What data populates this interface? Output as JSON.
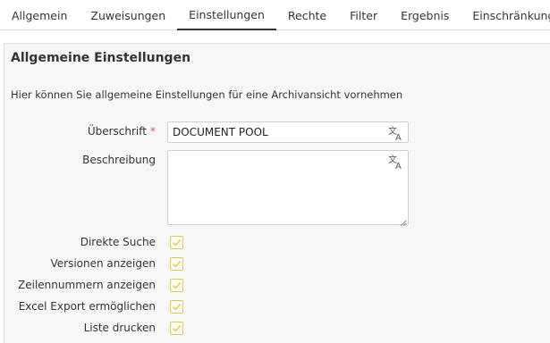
{
  "tabs": [
    {
      "label": "Allgemein"
    },
    {
      "label": "Zuweisungen"
    },
    {
      "label": "Einstellungen",
      "active": true
    },
    {
      "label": "Rechte"
    },
    {
      "label": "Filter"
    },
    {
      "label": "Ergebnis"
    },
    {
      "label": "Einschränkungen"
    }
  ],
  "section": {
    "title": "Allgemeine Einstellungen",
    "description": "Hier können Sie allgemeine Einstellungen für eine Archivansicht vornehmen"
  },
  "form": {
    "heading_label": "Überschrift",
    "required_marker": "*",
    "heading_value": "DOCUMENT POOL",
    "description_label": "Beschreibung",
    "description_value": "",
    "options": [
      {
        "label": "Direkte Suche",
        "checked": false
      },
      {
        "label": "Versionen anzeigen",
        "checked": false
      },
      {
        "label": "Zeilennummern anzeigen",
        "checked": false
      },
      {
        "label": "Excel Export ermöglichen",
        "checked": false
      },
      {
        "label": "Liste drucken",
        "checked": false
      }
    ]
  },
  "colors": {
    "checkbox_accent": "#e0c84a",
    "required": "#d9534f",
    "active_tab_underline": "#333333"
  },
  "icons": {
    "translate": "translate-icon",
    "checkbox_check": "check-icon"
  }
}
